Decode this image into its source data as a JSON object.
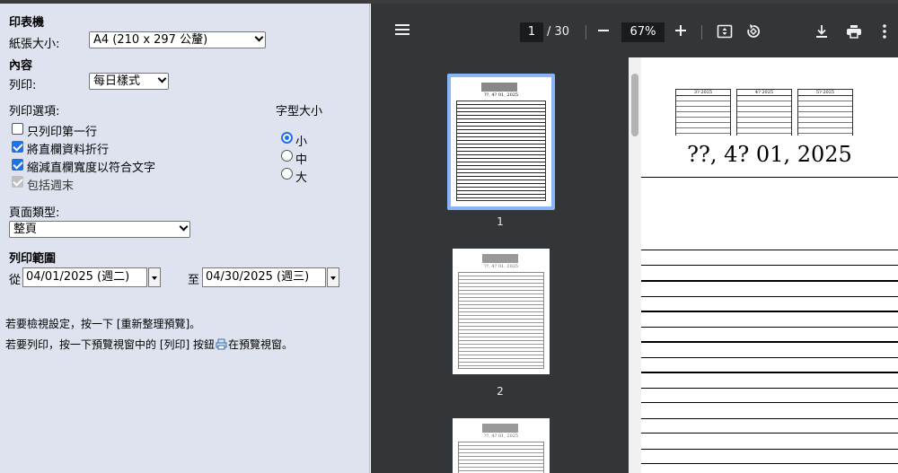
{
  "settings": {
    "printer_heading": "印表機",
    "paper_label": "紙張大小:",
    "paper_value": "A4 (210 x 297 公釐)",
    "content_heading": "內容",
    "print_label": "列印:",
    "print_value": "每日樣式",
    "options_label": "列印選項:",
    "opt_first_row": "只列印第一行",
    "opt_wrap": "將直欄資料折行",
    "opt_shrink": "縮減直欄寬度以符合文字",
    "opt_weekend": "包括週末",
    "font_size_label": "字型大小",
    "size_small": "小",
    "size_medium": "中",
    "size_large": "大",
    "page_type_label": "頁面類型:",
    "page_type_value": "整頁",
    "range_heading": "列印範圍",
    "from_label": "從",
    "from_value": "04/01/2025 (週二)",
    "to_label": "至",
    "to_value": "04/30/2025 (週三)",
    "hint1": "若要檢視設定，按一下 [重新整理預覽]。",
    "hint2a": "若要列印，按一下預覽視窗中的 [列印] 按鈕",
    "hint2b": "在預覽視窗。"
  },
  "viewer": {
    "page_current": "1",
    "page_total": "/ 30",
    "zoom": "67%",
    "thumb_labels": [
      "1",
      "2"
    ],
    "page_title": "??, 4? 01, 2025",
    "thumb_title": "??, 4? 01, 2025",
    "mini_calendars": [
      "3? 2025",
      "4? 2025",
      "5? 2025"
    ]
  },
  "icons": {
    "menu": "menu-icon",
    "zoom_out": "minus-icon",
    "zoom_in": "plus-icon",
    "fit": "fit-page-icon",
    "rotate": "rotate-icon",
    "download": "download-icon",
    "print": "print-icon",
    "more": "more-vert-icon",
    "print_button": "printer-icon"
  }
}
